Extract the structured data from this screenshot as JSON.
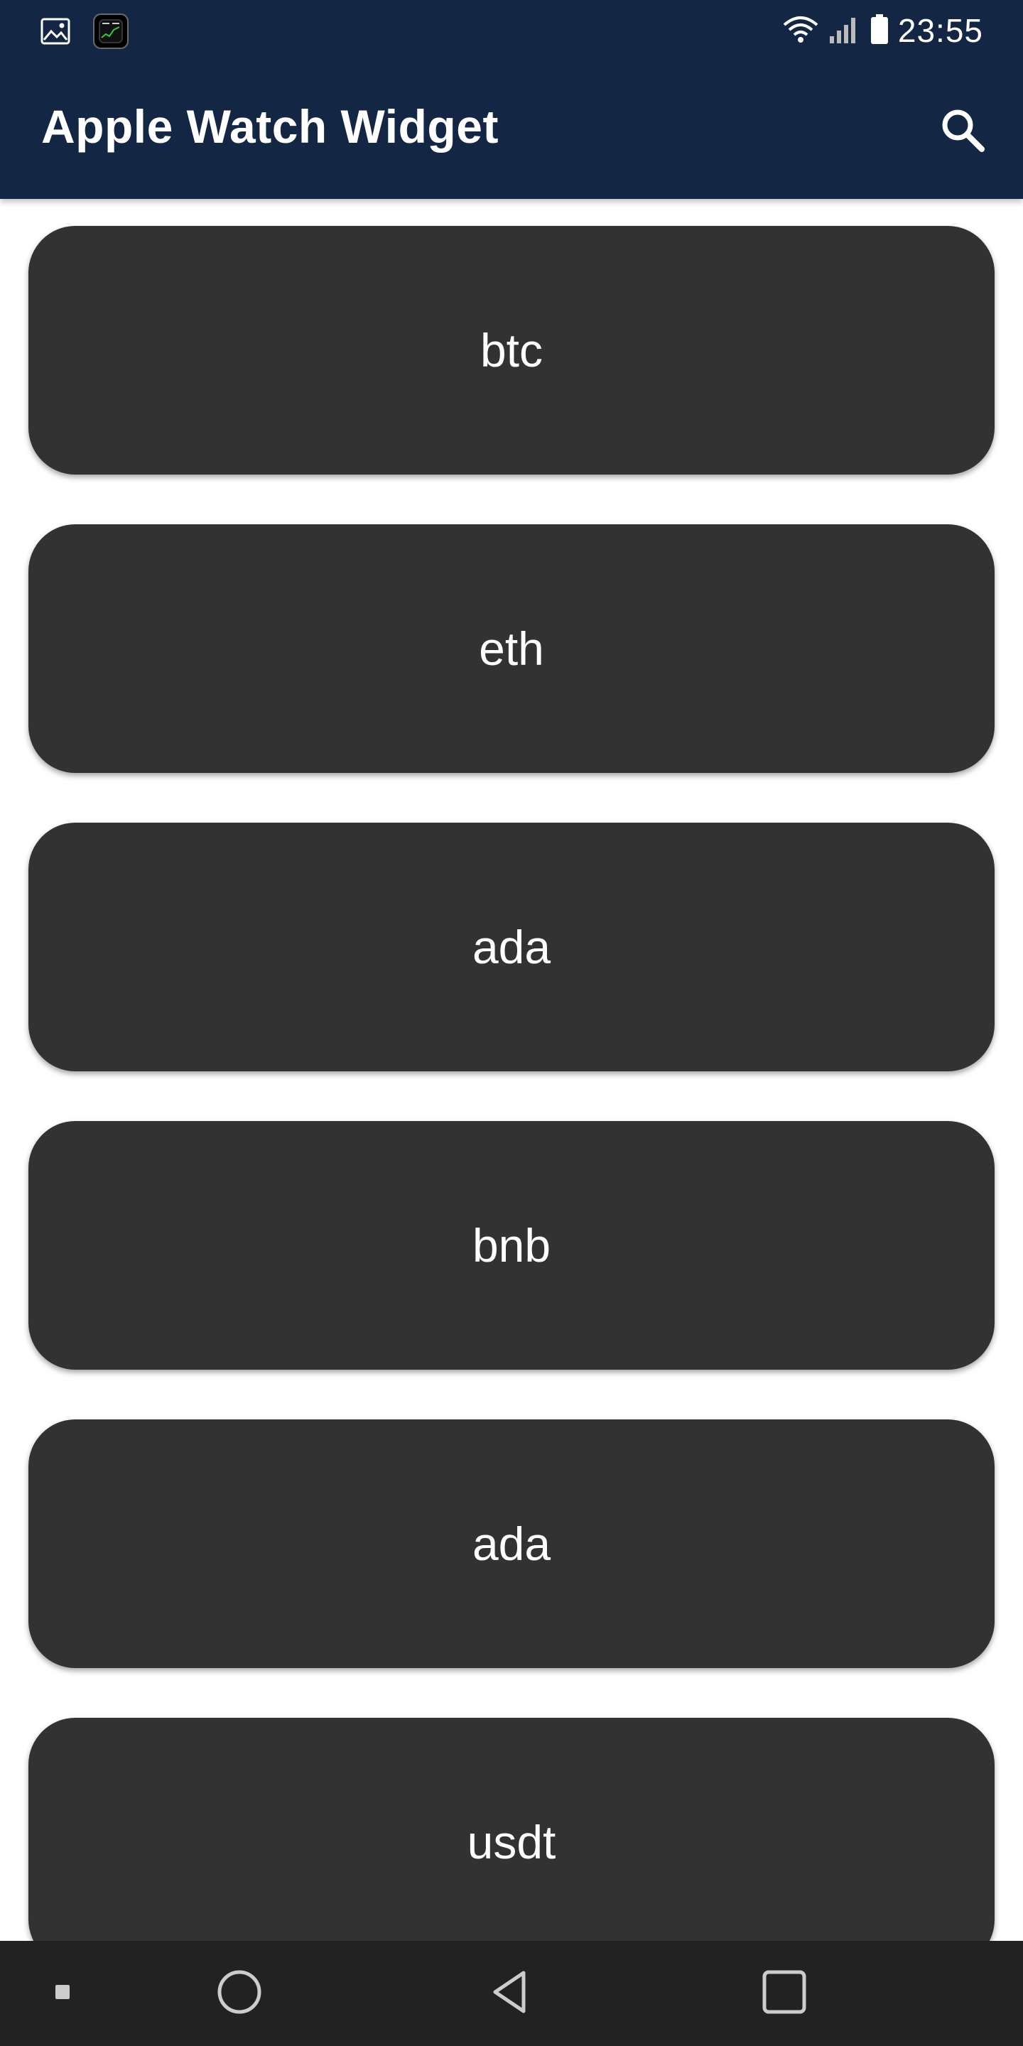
{
  "status_bar": {
    "time": "23:55",
    "left_icons": [
      "gallery-icon",
      "watch-app-icon"
    ],
    "right_icons": [
      "wifi-icon",
      "signal-icon",
      "battery-icon"
    ]
  },
  "app_bar": {
    "title": "Apple Watch Widget",
    "search_icon": "search-icon",
    "background": "#132744"
  },
  "coins": [
    {
      "label": "btc"
    },
    {
      "label": "eth"
    },
    {
      "label": "ada"
    },
    {
      "label": "bnb"
    },
    {
      "label": "ada"
    },
    {
      "label": "usdt"
    }
  ],
  "colors": {
    "card_background": "#323232",
    "card_text": "#ffffff",
    "nav_background": "#222222"
  },
  "nav_bar": {
    "icons": [
      "square-dot-icon",
      "home-circle-icon",
      "back-triangle-icon",
      "recents-square-icon"
    ]
  }
}
